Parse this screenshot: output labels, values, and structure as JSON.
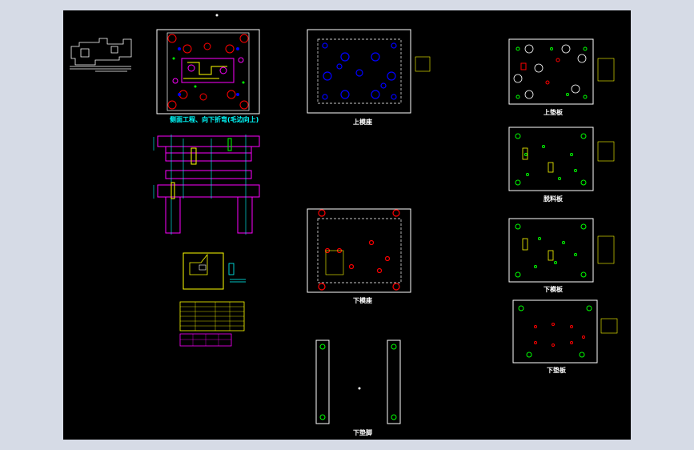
{
  "drawing": {
    "title_main": "侧面工程、向下折弯(毛边向上)",
    "upper_die_seat": "上模座",
    "lower_die_seat": "下模座",
    "upper_pad_plate": "上垫板",
    "stripper_plate": "脱料板",
    "lower_die_plate": "下模板",
    "lower_pad_plate": "下垫板",
    "lower_pad_feet": "下垫脚"
  },
  "colors": {
    "background": "#000000",
    "outline": "#ffffff",
    "title_cyan": "#00ffff",
    "magenta": "#ff00ff",
    "yellow": "#ffff00",
    "red": "#ff0000",
    "blue": "#0000ff",
    "green": "#00ff00"
  }
}
